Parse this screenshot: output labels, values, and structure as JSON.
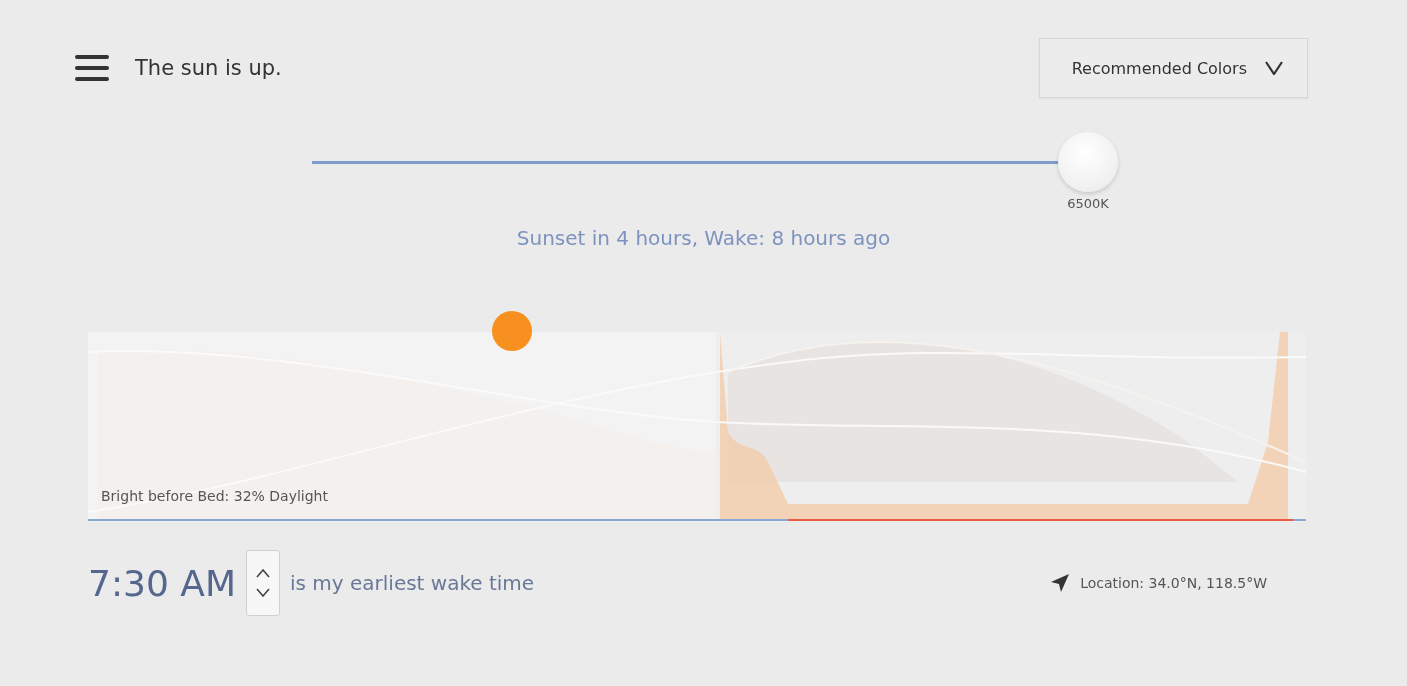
{
  "header": {
    "title": "The sun is up.",
    "dropdown": {
      "value": "Recommended Colors"
    }
  },
  "color_temperature": {
    "level": 1,
    "reading": "6500K"
  },
  "status": "Sunset in 4 hours, Wake: 8 hours ago",
  "daylight_graph": {
    "caption": "Bright before Bed: 32% Daylight"
  },
  "wake": {
    "time": "7:30 AM",
    "label": "is my earliest wake time"
  },
  "location": "Location: 34.0°N, 118.5°W"
}
